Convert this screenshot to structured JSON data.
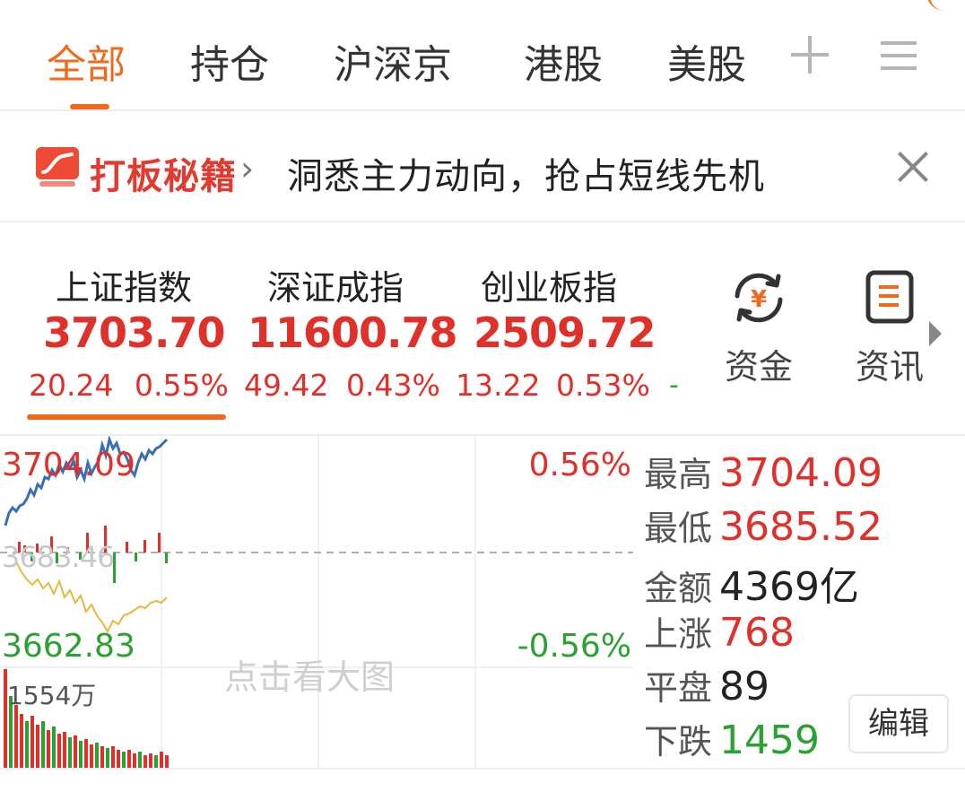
{
  "tabs": [
    {
      "label": "全部",
      "active": true
    },
    {
      "label": "持仓",
      "active": false
    },
    {
      "label": "沪深京",
      "active": false
    },
    {
      "label": "港股",
      "active": false
    },
    {
      "label": "美股",
      "active": false
    }
  ],
  "tab_icons": {
    "add": "plus-icon",
    "menu": "menu-icon"
  },
  "banner": {
    "title": "打板秘籍",
    "chevron": "›",
    "text": "洞悉主力动向，抢占短线先机",
    "close_icon": "close-icon"
  },
  "indices": [
    {
      "name": "上证指数",
      "value": "3703.70",
      "change": "20.24",
      "pct": "0.55%"
    },
    {
      "name": "深证成指",
      "value": "11600.78",
      "change": "49.42",
      "pct": "0.43%"
    },
    {
      "name": "创业板指",
      "value": "2509.72",
      "change": "13.22",
      "pct": "0.53%"
    }
  ],
  "indices_more": "-",
  "tools": [
    {
      "label": "资金",
      "icon": "yuan-cycle-icon"
    },
    {
      "label": "资讯",
      "icon": "document-icon"
    }
  ],
  "chart": {
    "high_label": "3704.09",
    "low_label": "3662.83",
    "pos_pct": "0.56%",
    "neg_pct": "-0.56%",
    "prev_close_label": "3683.46",
    "volume_label": "1554万",
    "click_hint": "点击看大图"
  },
  "stats": [
    {
      "label": "最高",
      "value": "3704.09",
      "color": "#e0302a"
    },
    {
      "label": "最低",
      "value": "3685.52",
      "color": "#e0302a"
    },
    {
      "label": "金额",
      "value": "4369亿",
      "color": "#222222"
    },
    {
      "label": "上涨",
      "value": "768",
      "color": "#e0302a"
    },
    {
      "label": "平盘",
      "value": "89",
      "color": "#222222"
    },
    {
      "label": "下跌",
      "value": "1459",
      "color": "#2aa130"
    }
  ],
  "edit_label": "编辑",
  "colors": {
    "accent": "#ef6a1d",
    "up": "#e0302a",
    "down": "#2aa130",
    "index_line": "#3a6fb5",
    "avg_line": "#e8b740"
  }
}
